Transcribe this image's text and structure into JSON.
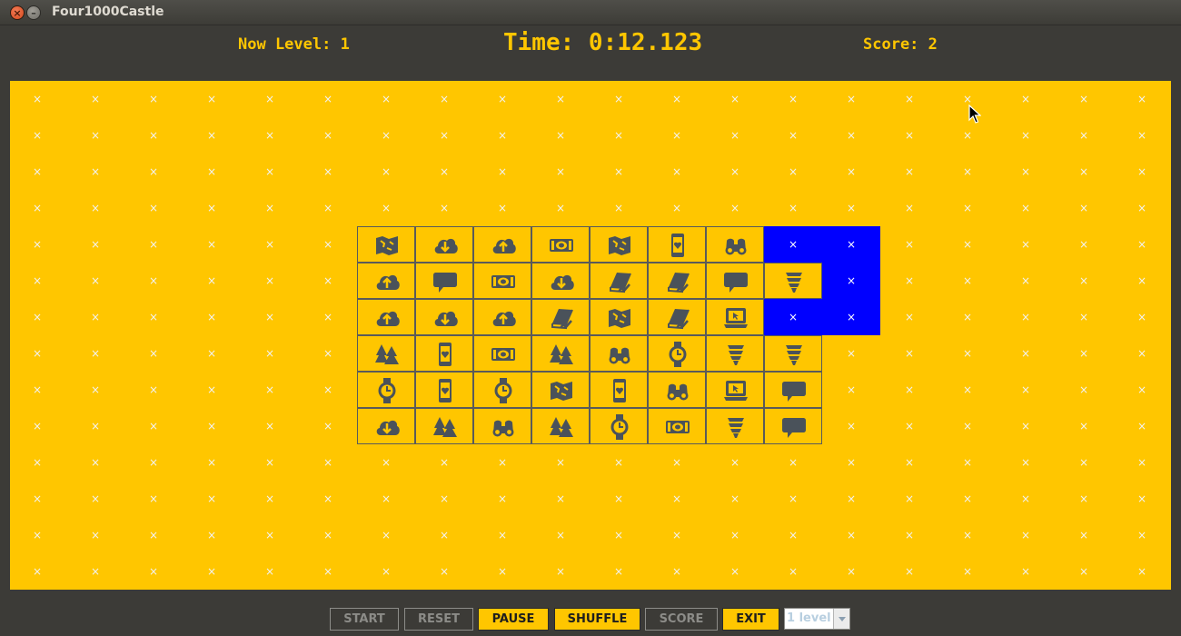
{
  "window": {
    "title": "Four1000Castle",
    "close_glyph": "×",
    "minimize_glyph": "–"
  },
  "header": {
    "level_text": "Now Level: 1",
    "time_text": "Time: 0:12.123",
    "score_text": "Score: 2"
  },
  "board": {
    "cols": 20,
    "rows": 14,
    "empty_mark": "×",
    "colors": {
      "background": "#ffc600",
      "highlight": "#0000ff",
      "icon": "#4a525a",
      "tile_border": "#5a5a5a"
    },
    "tiles": [
      [
        "map-icon",
        "cloud-download-icon",
        "cloud-upload-icon",
        "money-icon",
        "map-icon",
        "phone-heart-icon",
        "binoculars-icon",
        null,
        null
      ],
      [
        "cloud-upload-icon",
        "speech-bubble-icon",
        "money-icon",
        "cloud-download-icon",
        "book-icon",
        "book-icon",
        "speech-bubble-icon",
        "lightbulb-icon",
        null
      ],
      [
        "cloud-upload-icon",
        "cloud-download-icon",
        "cloud-upload-icon",
        "book-icon",
        "map-icon",
        "book-icon",
        "laptop-icon",
        null,
        null
      ],
      [
        "trees-icon",
        "phone-heart-icon",
        "money-icon",
        "trees-icon",
        "binoculars-icon",
        "watch-icon",
        "lightbulb-icon",
        "lightbulb-icon",
        null
      ],
      [
        "watch-icon",
        "phone-heart-icon",
        "watch-icon",
        "map-icon",
        "phone-heart-icon",
        "binoculars-icon",
        "laptop-icon",
        "speech-bubble-icon",
        null
      ],
      [
        "cloud-download-icon",
        "trees-icon",
        "binoculars-icon",
        "trees-icon",
        "watch-icon",
        "money-icon",
        "lightbulb-icon",
        "speech-bubble-icon",
        null
      ]
    ],
    "highlighted_path": [
      [
        0,
        7
      ],
      [
        0,
        8
      ],
      [
        1,
        8
      ],
      [
        2,
        7
      ],
      [
        2,
        8
      ]
    ]
  },
  "toolbar": {
    "buttons": [
      {
        "name": "start-button",
        "label": "START",
        "enabled": false
      },
      {
        "name": "reset-button",
        "label": "RESET",
        "enabled": false
      },
      {
        "name": "pause-button",
        "label": "PAUSE",
        "enabled": true
      },
      {
        "name": "shuffle-button",
        "label": "SHUFFLE",
        "enabled": true
      },
      {
        "name": "score-button",
        "label": "SCORE",
        "enabled": false
      },
      {
        "name": "exit-button",
        "label": "EXIT",
        "enabled": true
      }
    ],
    "level_select": {
      "value": "1 level",
      "enabled": false
    }
  }
}
